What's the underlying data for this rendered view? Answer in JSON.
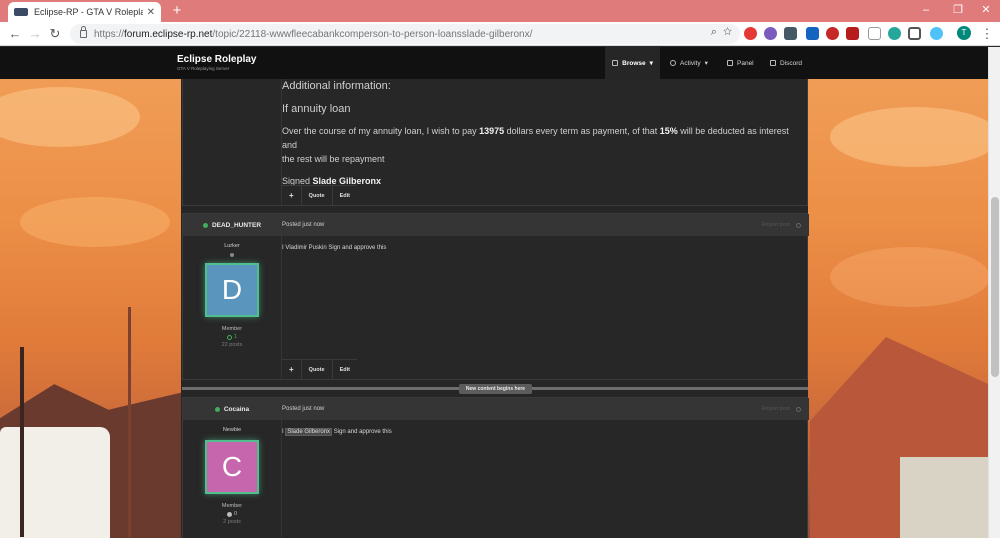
{
  "browser": {
    "tab_title": "Eclipse-RP - GTA V Roleplaying S",
    "url_prefix": "https://",
    "url_host": "forum.eclipse-rp.net",
    "url_path": "/topic/22118-wwwfleecabankcomperson-to-person-loansslade-gilberonx/",
    "profile_initial": "T"
  },
  "forum": {
    "brand_title": "Eclipse Roleplay",
    "brand_subtitle": "GTA V Roleplaying Server",
    "nav": {
      "browse": "Browse",
      "activity": "Activity",
      "panel": "Panel",
      "discord": "Discord"
    }
  },
  "first_post": {
    "additional_info": "Additional information:",
    "if_annuity": "If annuity loan",
    "line_1_a": "Over the course of my annuity loan, I wish to pay ",
    "amount": "13975",
    "line_1_b": " dollars every term as payment, of that ",
    "percent": "15%",
    "line_1_c": " will be deducted as interest and",
    "line_2": "the rest will be repayment",
    "signed_label": "Signed ",
    "signed_name": "Slade Gilberonx",
    "actions": {
      "plus": "+",
      "quote": "Quote",
      "edit": "Edit"
    }
  },
  "posts": [
    {
      "author": "DEAD_HUNTER",
      "date": "Posted just now",
      "report": "Report post",
      "rank": "Lurker",
      "avatar_letter": "D",
      "avatar_color": "#5a95bd",
      "group": "Member",
      "reputation": "1",
      "rep_color": "#3fae5e",
      "post_count": "22 posts",
      "body": "I Vladimir Puskin Sign and approve this",
      "actions": {
        "plus": "+",
        "quote": "Quote",
        "edit": "Edit"
      }
    },
    {
      "author": "Cocaina",
      "date": "Posted just now",
      "report": "Report post",
      "rank": "Newbie",
      "avatar_letter": "C",
      "avatar_color": "#c667ad",
      "group": "Member",
      "reputation": "0",
      "rep_color": "#bbbbbb",
      "post_count": "2 posts",
      "body_prefix": "I ",
      "body_highlight": "Slade Gilberonx",
      "body_suffix": " Sign and approve this"
    }
  ],
  "new_content_label": "New content begins here"
}
